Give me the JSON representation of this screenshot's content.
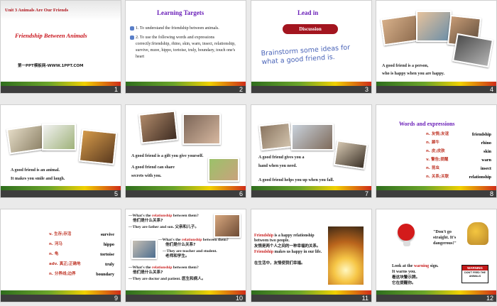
{
  "slides": [
    {
      "num": "1",
      "subtitle": "Unit 3 Animals Are Our Friends",
      "title": "Friendship Between Animals",
      "footer": "第一PPT模板网-WWW.1PPT.COM"
    },
    {
      "num": "2",
      "title": "Learning Targets",
      "point1": "1. To understand the friendship between animals.",
      "point2": "2. To use the following words and expressions correctly:friendship, rhino, skin, warn, insect, relationship, survive, mzee, hippo, tortoise, truly, boundary, touch one's heart"
    },
    {
      "num": "3",
      "title": "Lead in",
      "button": "Discussion",
      "prompt": "Brainstorm some ideas for what a good friend is."
    },
    {
      "num": "4",
      "line1": "A good friend is a person,",
      "line2": "who is happy when you are happy."
    },
    {
      "num": "5",
      "line1": "A good friend is an animal.",
      "line2": "It makes you smile and laugh."
    },
    {
      "num": "6",
      "line1": "A good friend is a gift you give yourself.",
      "line2": "A good friend can share",
      "line3": "secrets with you."
    },
    {
      "num": "7",
      "line1": "A good friend gives you a",
      "line2": "hand when you need.",
      "line3": "A good friend helps you up when you fall."
    },
    {
      "num": "8",
      "title": "Words and expressions",
      "words": [
        {
          "en": "friendship",
          "zh": "n. 友情;友谊"
        },
        {
          "en": "rhino",
          "zh": "n. 犀牛"
        },
        {
          "en": "skin",
          "zh": "n. 皮;皮肤"
        },
        {
          "en": "warn",
          "zh": "v. 警告;提醒"
        },
        {
          "en": "insect",
          "zh": "n. 昆虫"
        },
        {
          "en": "relationship",
          "zh": "n. 关系;关联"
        }
      ]
    },
    {
      "num": "9",
      "words": [
        {
          "en": "survive",
          "zh": "v. 生存;存活"
        },
        {
          "en": "hippo",
          "zh": "n. 河马"
        },
        {
          "en": "tortoise",
          "zh": "n. 龟"
        },
        {
          "en": "truly",
          "zh": "adv. 真正;正确地"
        },
        {
          "en": "boundary",
          "zh": "n. 分界线;边界"
        }
      ]
    },
    {
      "num": "10",
      "q1a": "—What's the ",
      "q1b": "relationship",
      "q1c": " between them?",
      "q1zh": "他们是什么关系?",
      "a1": "—They are father and son. 父亲和儿子。",
      "q2a": "—What's the ",
      "q2b": "relationship",
      "q2c": " between them?",
      "q2zh": "他们是什么关系?",
      "a2": "—They are teacher and student.",
      "a2zh": "老师和学生。",
      "q3a": "—What's the ",
      "q3b": "relationship",
      "q3c": " between them?",
      "q3zh": "他们是什么关系?",
      "a3": "—They are doctor and patient. 医生和病人。"
    },
    {
      "num": "11",
      "k1": "Friendship",
      "t1": " is a happy relationship between two people.",
      "z1": "友情是两个人之间的一种幸福的关系。",
      "k2": "Friendship",
      "t2": " makes us happy in our life.",
      "z2": "在生活中，友情使我们幸福。"
    },
    {
      "num": "12",
      "quote": "\"Don't go straight. It's dangerous!\"",
      "l1a": "Look at the ",
      "l1b": "warning",
      "l1c": " sign.",
      "l2": "It warns you.",
      "l3": "看这块警示牌。",
      "l4": "它在提醒你。",
      "sign1": "WARNING",
      "sign2": "DON'T FEED THE ANIMALS"
    }
  ]
}
